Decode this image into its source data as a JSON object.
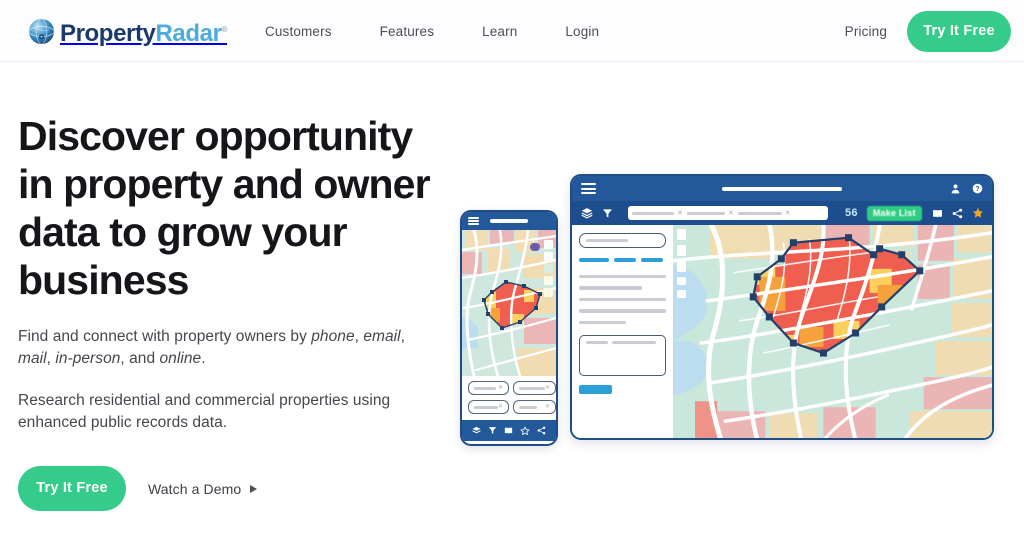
{
  "brand": {
    "name_part1": "Property",
    "name_part2": "Radar",
    "trademark": "®",
    "logo_icon": "globe-icon",
    "color_dark": "#1b3a6b",
    "color_light": "#4eabdc"
  },
  "nav": {
    "links": [
      {
        "label": "Customers"
      },
      {
        "label": "Features"
      },
      {
        "label": "Learn"
      },
      {
        "label": "Login"
      }
    ],
    "pricing_label": "Pricing",
    "cta_label": "Try It Free",
    "cta_color": "#35cb8a"
  },
  "hero": {
    "headline": "Discover opportunity in property and owner data to grow your business",
    "paragraph1_prefix": "Find and connect with property owners by ",
    "paragraph1_em1": "phone",
    "paragraph1_mid1": ", ",
    "paragraph1_em2": "email",
    "paragraph1_mid2": ", ",
    "paragraph1_em3": "mail",
    "paragraph1_mid3": ", ",
    "paragraph1_em4": "in-person",
    "paragraph1_mid4": ", and ",
    "paragraph1_em5": "online",
    "paragraph1_suffix": ".",
    "paragraph2": "Research residential and commercial properties using enhanced public records data.",
    "cta_label": "Try It Free",
    "demo_label": "Watch a Demo",
    "demo_icon": "play-triangle-icon"
  },
  "mockup_desktop": {
    "menu_icon": "hamburger-menu-icon",
    "title_placeholder": "",
    "account_icon": "user-account-icon",
    "help_icon": "help-question-icon",
    "layers_icon": "layers-stack-icon",
    "filter_icon": "funnel-filter-icon",
    "search_chips": [
      {
        "remove_icon": "close-x-icon"
      },
      {
        "remove_icon": "close-x-icon"
      },
      {
        "remove_icon": "close-x-icon"
      }
    ],
    "result_count": "56",
    "make_list_label": "Make List",
    "make_list_color": "#2ecc82",
    "book_icon": "open-book-icon",
    "share_icon": "share-nodes-icon",
    "star_icon": "star-icon",
    "star_color": "#f2a624",
    "sidebar": {
      "search_placeholder": "",
      "tab_count": 3,
      "text_line_count": 5,
      "card_label": "",
      "submit_label": ""
    },
    "map": {
      "polygon_label": "selection-polygon",
      "water_color": "#bcdcf0",
      "green_color": "#bee0d2",
      "parcel_red": "#ef5e4e",
      "parcel_orange": "#f6a13c",
      "parcel_yellow": "#fbd05c",
      "parcel_pink": "#efa9ac",
      "parcel_tan": "#f3dcb0",
      "polygon_stroke": "#23406b"
    }
  },
  "mockup_phone": {
    "menu_icon": "hamburger-menu-icon",
    "pin_icon": "map-pin-icon",
    "filters": [
      {
        "remove_icon": "close-x-icon"
      },
      {
        "remove_icon": "close-x-icon"
      },
      {
        "remove_icon": "close-x-icon"
      },
      {
        "remove_icon": "close-x-icon"
      }
    ],
    "toolbar_icons": [
      "layers-stack-icon",
      "funnel-filter-icon",
      "open-book-icon",
      "star-outline-icon",
      "share-nodes-icon"
    ]
  }
}
